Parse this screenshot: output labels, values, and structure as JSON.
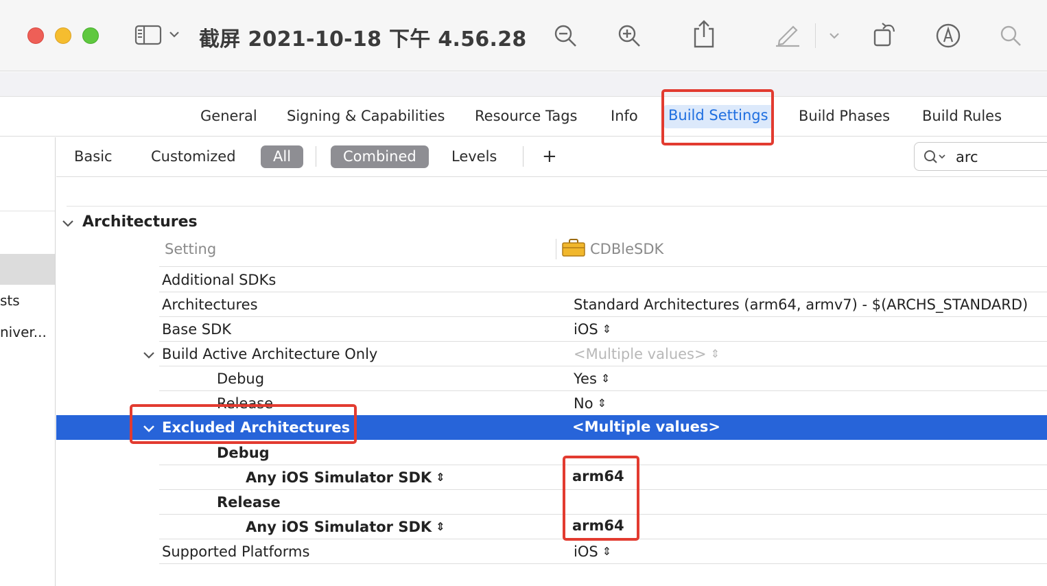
{
  "window": {
    "title": "截屏 2021-10-18 下午 4.56.28",
    "toolbar_icons": [
      "sidebar-toggle-icon",
      "chevron-down-icon",
      "zoom-out-icon",
      "zoom-in-icon",
      "share-icon",
      "markup-pen-icon",
      "chevron-down-icon",
      "rotate-icon",
      "annotate-icon",
      "search-icon"
    ]
  },
  "tabs": [
    {
      "label": "General"
    },
    {
      "label": "Signing & Capabilities"
    },
    {
      "label": "Resource Tags"
    },
    {
      "label": "Info"
    },
    {
      "label": "Build Settings",
      "selected": true
    },
    {
      "label": "Build Phases"
    },
    {
      "label": "Build Rules"
    }
  ],
  "sidebar": {
    "items": [
      {
        "label": "sts"
      },
      {
        "label": "niver..."
      }
    ]
  },
  "filter": {
    "basic": "Basic",
    "customized": "Customized",
    "all": "All",
    "combined": "Combined",
    "levels": "Levels",
    "add": "+",
    "search_value": "arc"
  },
  "section": {
    "title": "Architectures",
    "col_setting": "Setting",
    "col_target": "CDBleSDK"
  },
  "rows": [
    {
      "name": "Additional SDKs",
      "value": ""
    },
    {
      "name": "Architectures",
      "value": "Standard Architectures (arm64, armv7)  -  $(ARCHS_STANDARD)"
    },
    {
      "name": "Base SDK",
      "value": "iOS"
    },
    {
      "name": "Build Active Architecture Only",
      "value": "<Multiple values>"
    },
    {
      "name": "Debug",
      "value": "Yes"
    },
    {
      "name": "Release",
      "value": "No"
    },
    {
      "name": "Excluded Architectures",
      "value": "<Multiple values>"
    },
    {
      "name": "Debug",
      "value": ""
    },
    {
      "name": "Any iOS Simulator SDK",
      "value": "arm64"
    },
    {
      "name": "Release",
      "value": ""
    },
    {
      "name": "Any iOS Simulator SDK",
      "value": "arm64"
    },
    {
      "name": "Supported Platforms",
      "value": "iOS"
    }
  ],
  "colors": {
    "selection": "#2764d9",
    "highlight_box": "#e23b30",
    "tab_selected": "#1f6fe0"
  }
}
